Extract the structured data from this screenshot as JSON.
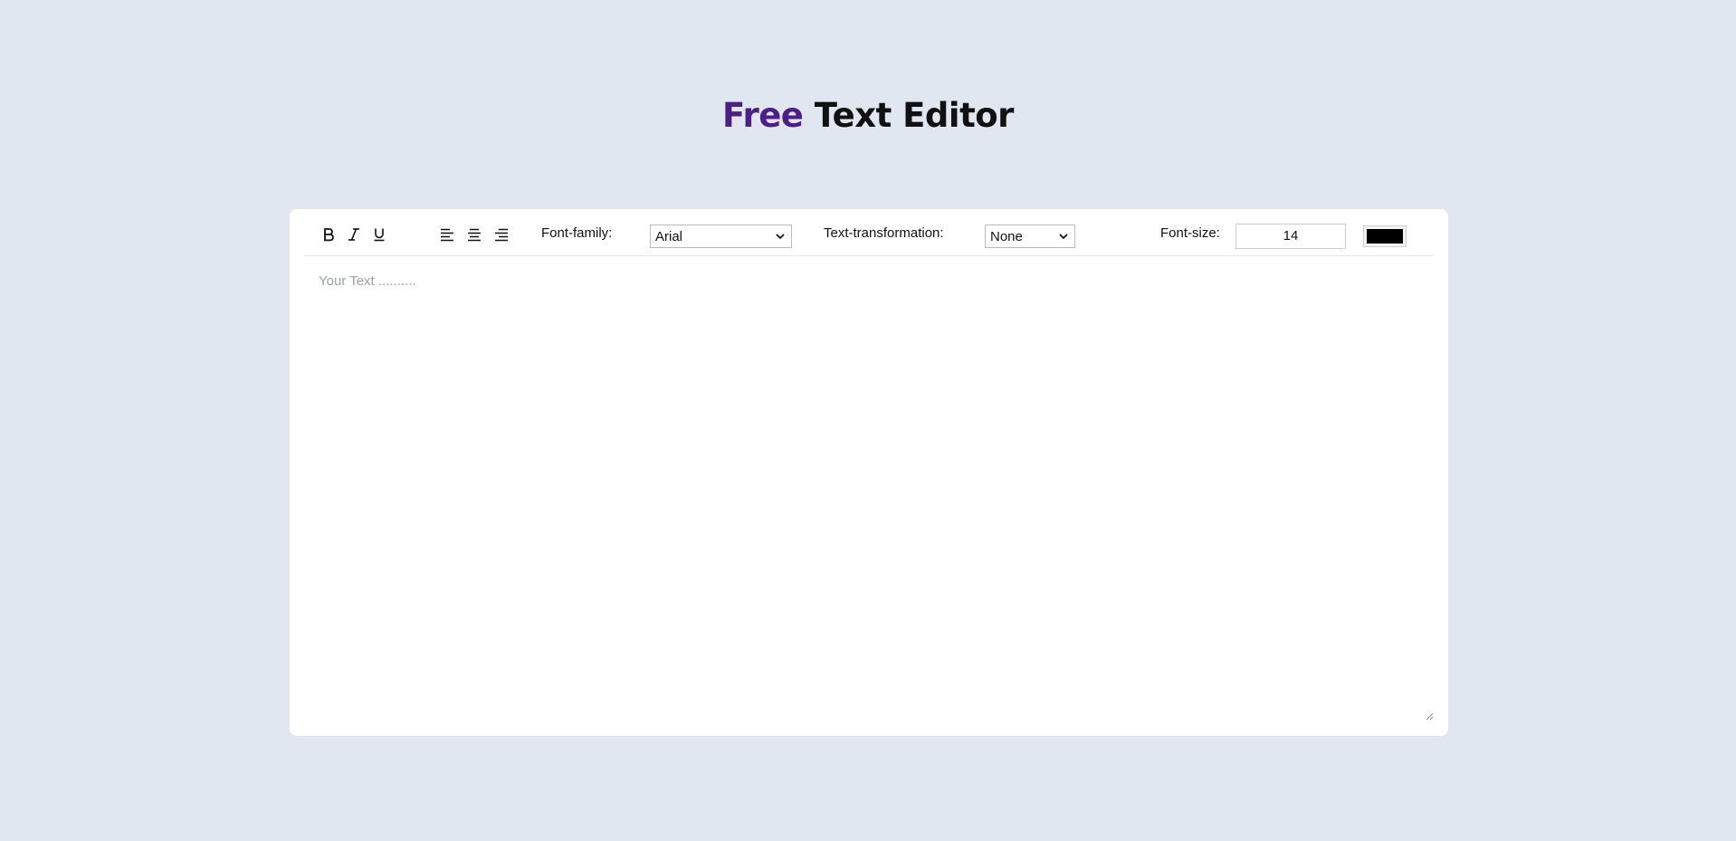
{
  "header": {
    "title_accent": "Free",
    "title_rest": "Text Editor",
    "accent_color": "#4d1e87"
  },
  "toolbar": {
    "format_buttons": [
      {
        "name": "bold-icon",
        "glyph": "B"
      },
      {
        "name": "italic-icon",
        "glyph": "I"
      },
      {
        "name": "underline-icon",
        "glyph": "U"
      }
    ],
    "align_buttons": [
      {
        "name": "align-left-icon"
      },
      {
        "name": "align-center-icon"
      },
      {
        "name": "align-right-icon"
      }
    ],
    "font_family": {
      "label": "Font-family:",
      "value": "Arial"
    },
    "text_transformation": {
      "label": "Text-transformation:",
      "value": "None"
    },
    "font_size": {
      "label": "Font-size:",
      "value": "14"
    },
    "text_color": "#000000"
  },
  "editor": {
    "placeholder": "Your Text .........."
  }
}
